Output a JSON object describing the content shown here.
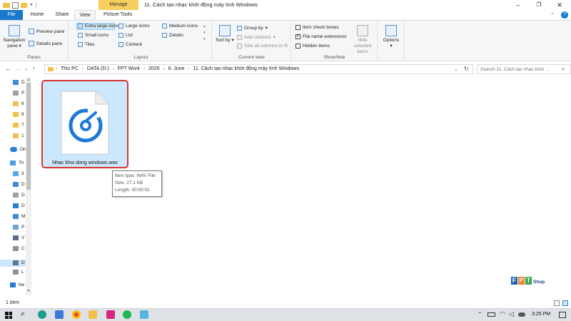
{
  "titlebar": {
    "context_tab": "Manage",
    "title": "11. Cách tạo nhạc khởi động máy tính Windows"
  },
  "ribbon_tabs": {
    "file": "File",
    "home": "Home",
    "share": "Share",
    "view": "View",
    "picture_tools": "Picture Tools"
  },
  "ribbon": {
    "panes": {
      "navigation_pane": "Navigation pane",
      "preview_pane": "Preview pane",
      "details_pane": "Details pane",
      "label": "Panes"
    },
    "layout": {
      "extra_large_icons": "Extra large icons",
      "large_icons": "Large icons",
      "medium_icons": "Medium icons",
      "small_icons": "Small icons",
      "list": "List",
      "details": "Details",
      "tiles": "Tiles",
      "content": "Content",
      "label": "Layout"
    },
    "current_view": {
      "sort_by": "Sort by",
      "group_by": "Group by",
      "add_columns": "Add columns",
      "size_all_columns": "Size all columns to fit",
      "label": "Current view"
    },
    "show_hide": {
      "item_check_boxes": "Item check boxes",
      "file_name_extensions": "File name extensions",
      "hidden_items": "Hidden items",
      "hide_selected_items": "Hide selected items",
      "label": "Show/hide"
    },
    "options": "Options"
  },
  "address": {
    "breadcrumbs": [
      "This PC",
      "DATA (D:)",
      "FPT Work",
      "2026",
      "6. June",
      "11. Cách tạo nhạc khởi động máy tính Windows"
    ],
    "search_placeholder": "Search 11. Cách tạo nhạc khởi ..."
  },
  "nav_pane": {
    "items": [
      "D",
      "P",
      "6",
      "9",
      "T",
      "1",
      "On",
      "Th",
      "3",
      "D",
      "D",
      "D",
      "M",
      "P",
      "V",
      "C",
      "D",
      "L",
      "Ne"
    ]
  },
  "content": {
    "file_name": "Nhac khoi dong windows.wav",
    "tooltip": {
      "type": "Item type: WAV File",
      "size": "Size: 27.1 KB",
      "length": "Length: 00:00:01"
    }
  },
  "status": {
    "item_count": "1 item"
  },
  "watermark": {
    "letters": [
      "F",
      "P",
      "T"
    ],
    "shop": "Shop"
  },
  "taskbar": {
    "clock": "3:25 PM"
  },
  "colors": {
    "accent_blue": "#1979ca",
    "manage_tab": "#f6ce5f",
    "selection": "#cce8ff",
    "highlight_ring": "#d9342b",
    "wav_icon": "#1b7ad6"
  }
}
